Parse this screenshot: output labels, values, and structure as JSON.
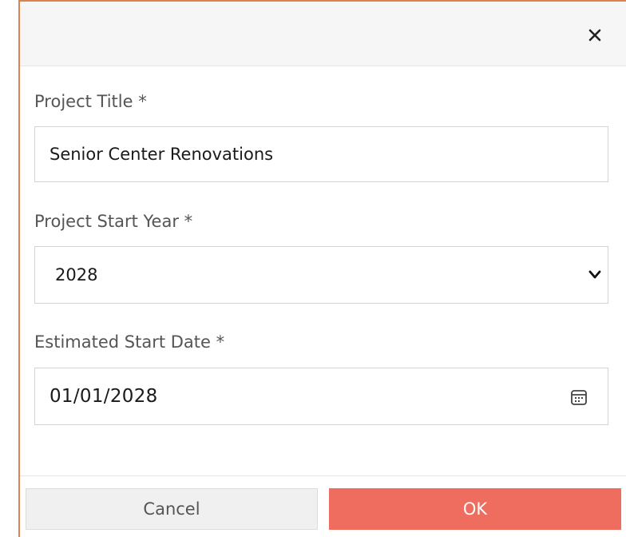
{
  "dialog": {
    "close_glyph": "✕",
    "close_icon": "close-icon"
  },
  "fields": {
    "project_title": {
      "label": "Project Title *",
      "value": "Senior Center Renovations"
    },
    "start_year": {
      "label": "Project Start Year *",
      "selected": "2028",
      "icon": "chevron-down-icon"
    },
    "start_date": {
      "label": "Estimated Start Date *",
      "value": "01/01/2028",
      "icon": "calendar-icon"
    }
  },
  "buttons": {
    "cancel_label": "Cancel",
    "ok_label": "OK"
  },
  "colors": {
    "accent_border": "#d9834f",
    "ok_button": "#ee6d5f"
  }
}
